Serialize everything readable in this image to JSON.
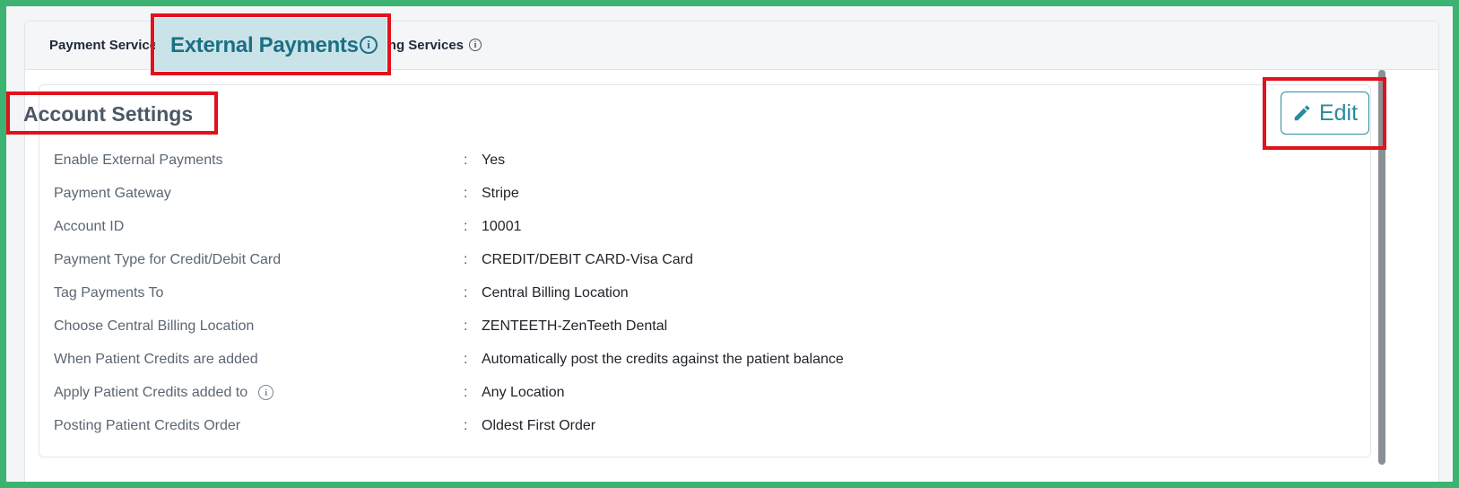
{
  "tabs": {
    "payment_services_label": "Payment Services",
    "external_payments_label": "External Payments",
    "billing_services_label": "Billing Services"
  },
  "section": {
    "title": "Account Settings",
    "edit_label": "Edit"
  },
  "settings": [
    {
      "label": "Enable External Payments",
      "value": "Yes"
    },
    {
      "label": "Payment Gateway",
      "value": "Stripe"
    },
    {
      "label": "Account ID",
      "value": "10001"
    },
    {
      "label": "Payment Type for Credit/Debit Card",
      "value": "CREDIT/DEBIT CARD-Visa Card"
    },
    {
      "label": "Tag Payments To",
      "value": "Central Billing Location"
    },
    {
      "label": "Choose Central Billing Location",
      "value": "ZENTEETH-ZenTeeth Dental"
    },
    {
      "label": "When Patient Credits are added",
      "value": "Automatically post the credits against the patient balance"
    },
    {
      "label": "Apply Patient Credits added to",
      "value": "Any Location"
    },
    {
      "label": "Posting Patient Credits Order",
      "value": "Oldest First Order"
    }
  ],
  "separator": ":",
  "icons": {
    "info": "info-icon",
    "edit": "pencil-icon"
  },
  "colors": {
    "accent": "#2a8b9c",
    "active_tab_bg": "#c9e3e8",
    "highlight_border": "#e0121b",
    "frame": "#3cb371"
  }
}
